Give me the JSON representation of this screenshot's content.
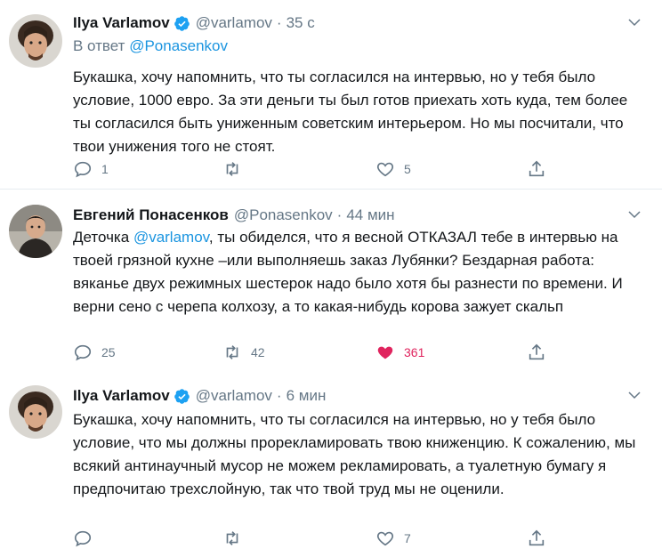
{
  "tweets": [
    {
      "name": "Ilya Varlamov",
      "handle": "@varlamov",
      "dot": "·",
      "time": "35 с",
      "reply_prefix": "В ответ",
      "reply_to": "@Ponasenkov",
      "text": "Букашка, хочу напомнить, что ты согласился на интервью, но у тебя было условие, 1000 евро. За эти деньги ты был готов приехать хоть куда, тем более ты согласился быть униженным советским интерьером. Но мы посчитали, что твои унижения того не стоят.",
      "replies": "1",
      "retweets": "",
      "likes": "5"
    },
    {
      "name": "Евгений Понасенков",
      "handle": "@Ponasenkov",
      "dot": "·",
      "time": "44 мин",
      "text_before": "Деточка ",
      "mention": "@varlamov",
      "text_after": ", ты обиделся, что я весной ОТКАЗАЛ тебе в интервью на твоей грязной кухне –или выполняешь заказ Лубянки? Бездарная работа: вяканье двух режимных шестерок надо было хотя бы разнести по времени. И верни сено с черепа колхозу, а то какая-нибудь корова зажует скальп",
      "replies": "25",
      "retweets": "42",
      "likes": "361"
    },
    {
      "name": "Ilya Varlamov",
      "handle": "@varlamov",
      "dot": "·",
      "time": "6 мин",
      "text": "Букашка, хочу напомнить, что ты согласился на интервью, но у тебя было условие, что мы должны прорекламировать твою книженцию. К сожалению, мы всякий антинаучный мусор не можем рекламировать, а туалетную бумагу я предпочитаю трехслойную, так что твой труд мы не оценили.",
      "replies": "",
      "retweets": "",
      "likes": "7"
    }
  ],
  "icons": {
    "reply": "reply-icon",
    "retweet": "retweet-icon",
    "like": "heart-icon",
    "share": "share-icon",
    "verified": "verified-badge-icon",
    "caret": "chevron-down-icon"
  },
  "colors": {
    "link": "#1b95e0",
    "muted": "#657786",
    "liked": "#e0245e",
    "verified": "#1da1f2"
  }
}
